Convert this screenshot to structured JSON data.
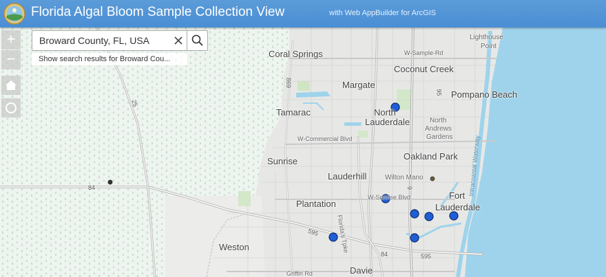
{
  "header": {
    "title": "Florida Algal Bloom Sample Collection View",
    "subtitle": "with Web AppBuilder for ArcGIS"
  },
  "controls": {
    "zoom_in": "+",
    "zoom_out": "−"
  },
  "search": {
    "value": "Broward County, FL, USA",
    "suggestion": "Show search results for Broward Cou..."
  },
  "map": {
    "places": {
      "coral_springs": "Coral Springs",
      "margate": "Margate",
      "coconut_creek": "Coconut Creek",
      "pompano_beach": "Pompano Beach",
      "lighthouse_point_1": "Lighthouse",
      "lighthouse_point_2": "Point",
      "tamarac": "Tamarac",
      "north_lauderdale_1": "North",
      "north_lauderdale_2": "Lauderdale",
      "north_andrews_1": "North",
      "north_andrews_2": "Andrews",
      "north_andrews_3": "Gardens",
      "sunrise": "Sunrise",
      "oakland_park": "Oakland Park",
      "lauderhill": "Lauderhill",
      "wilton_manors": "Wilton Mano",
      "fort_lauderdale_1": "Fort",
      "fort_lauderdale_2": "Lauderdale",
      "plantation": "Plantation",
      "weston": "Weston",
      "davie": "Davie"
    },
    "roads": {
      "sample_rd": "W-Sample-Rd",
      "commercial_blvd": "W-Commercial Blvd",
      "sunrise_blvd": "W-Sunrise Blvd",
      "griffin_rd": "Griffin Rd",
      "florida_tpke": "Florida's Tpke",
      "intracoastal": "Intracoastal Waterway"
    },
    "highways": {
      "h25": "25",
      "h84": "84",
      "h869": "869",
      "h95": "95",
      "h9": "9",
      "h595a": "595",
      "h595b": "595",
      "h84b": "84"
    },
    "colors": {
      "water": "#9fd3ec",
      "land": "#f0f2ed",
      "urban": "#e6e6e6",
      "marker_fill": "#1f5ed6",
      "marker_stroke": "#0b2a66",
      "header": "#4a8ed4"
    }
  }
}
